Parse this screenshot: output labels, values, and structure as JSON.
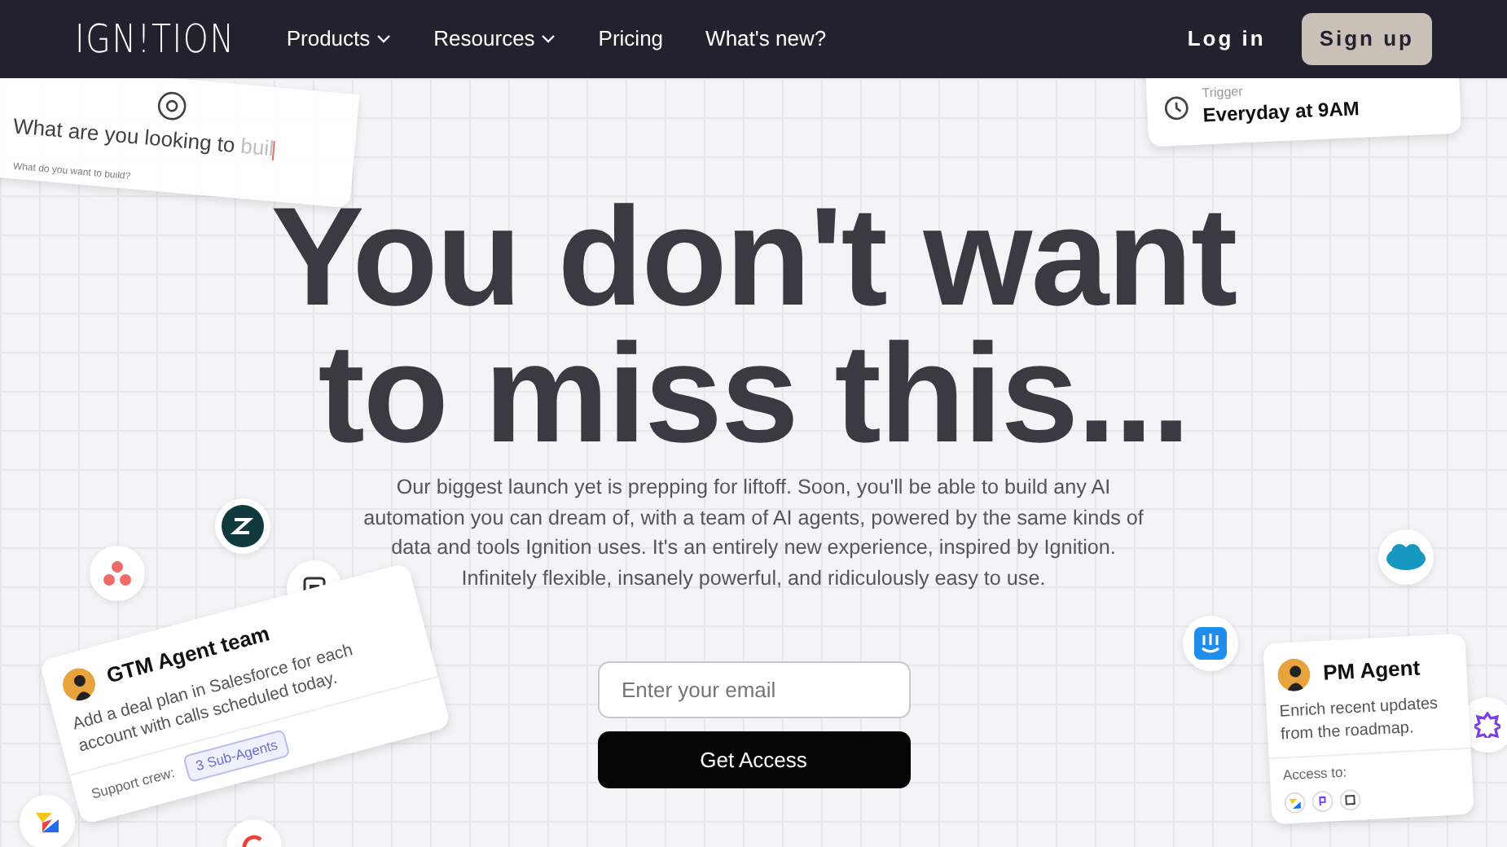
{
  "navbar": {
    "logo": "IGN!TION",
    "links": [
      {
        "label": "Products",
        "dropdown": true
      },
      {
        "label": "Resources",
        "dropdown": true
      },
      {
        "label": "Pricing",
        "dropdown": false
      },
      {
        "label": "What's new?",
        "dropdown": false
      }
    ],
    "login": "Log in",
    "signup": "Sign up"
  },
  "search_card": {
    "prompt": "What are you looking to",
    "typed": "buil",
    "placeholder": "What do you want to build?"
  },
  "trigger_card": {
    "label": "Trigger",
    "value": "Everyday at 9AM"
  },
  "hero": {
    "headline": "You don't want to miss this...",
    "body": "Our biggest launch yet is prepping for liftoff. Soon, you'll be able to build any AI automation you can dream of, with a team of AI agents, powered by the same kinds of data and tools Ignition uses. It's an entirely new experience, inspired by Ignition. Infinitely flexible, insanely powerful, and ridiculously easy to use.",
    "email_placeholder": "Enter your email",
    "button": "Get Access"
  },
  "gtm_card": {
    "title": "GTM Agent team",
    "description": "Add a deal plan in Salesforce for each account with calls scheduled today.",
    "footer_label": "Support crew:",
    "tag": "3 Sub-Agents"
  },
  "pm_card": {
    "title": "PM Agent",
    "description": "Enrich recent updates from the roadmap.",
    "footer_label": "Access to:"
  }
}
